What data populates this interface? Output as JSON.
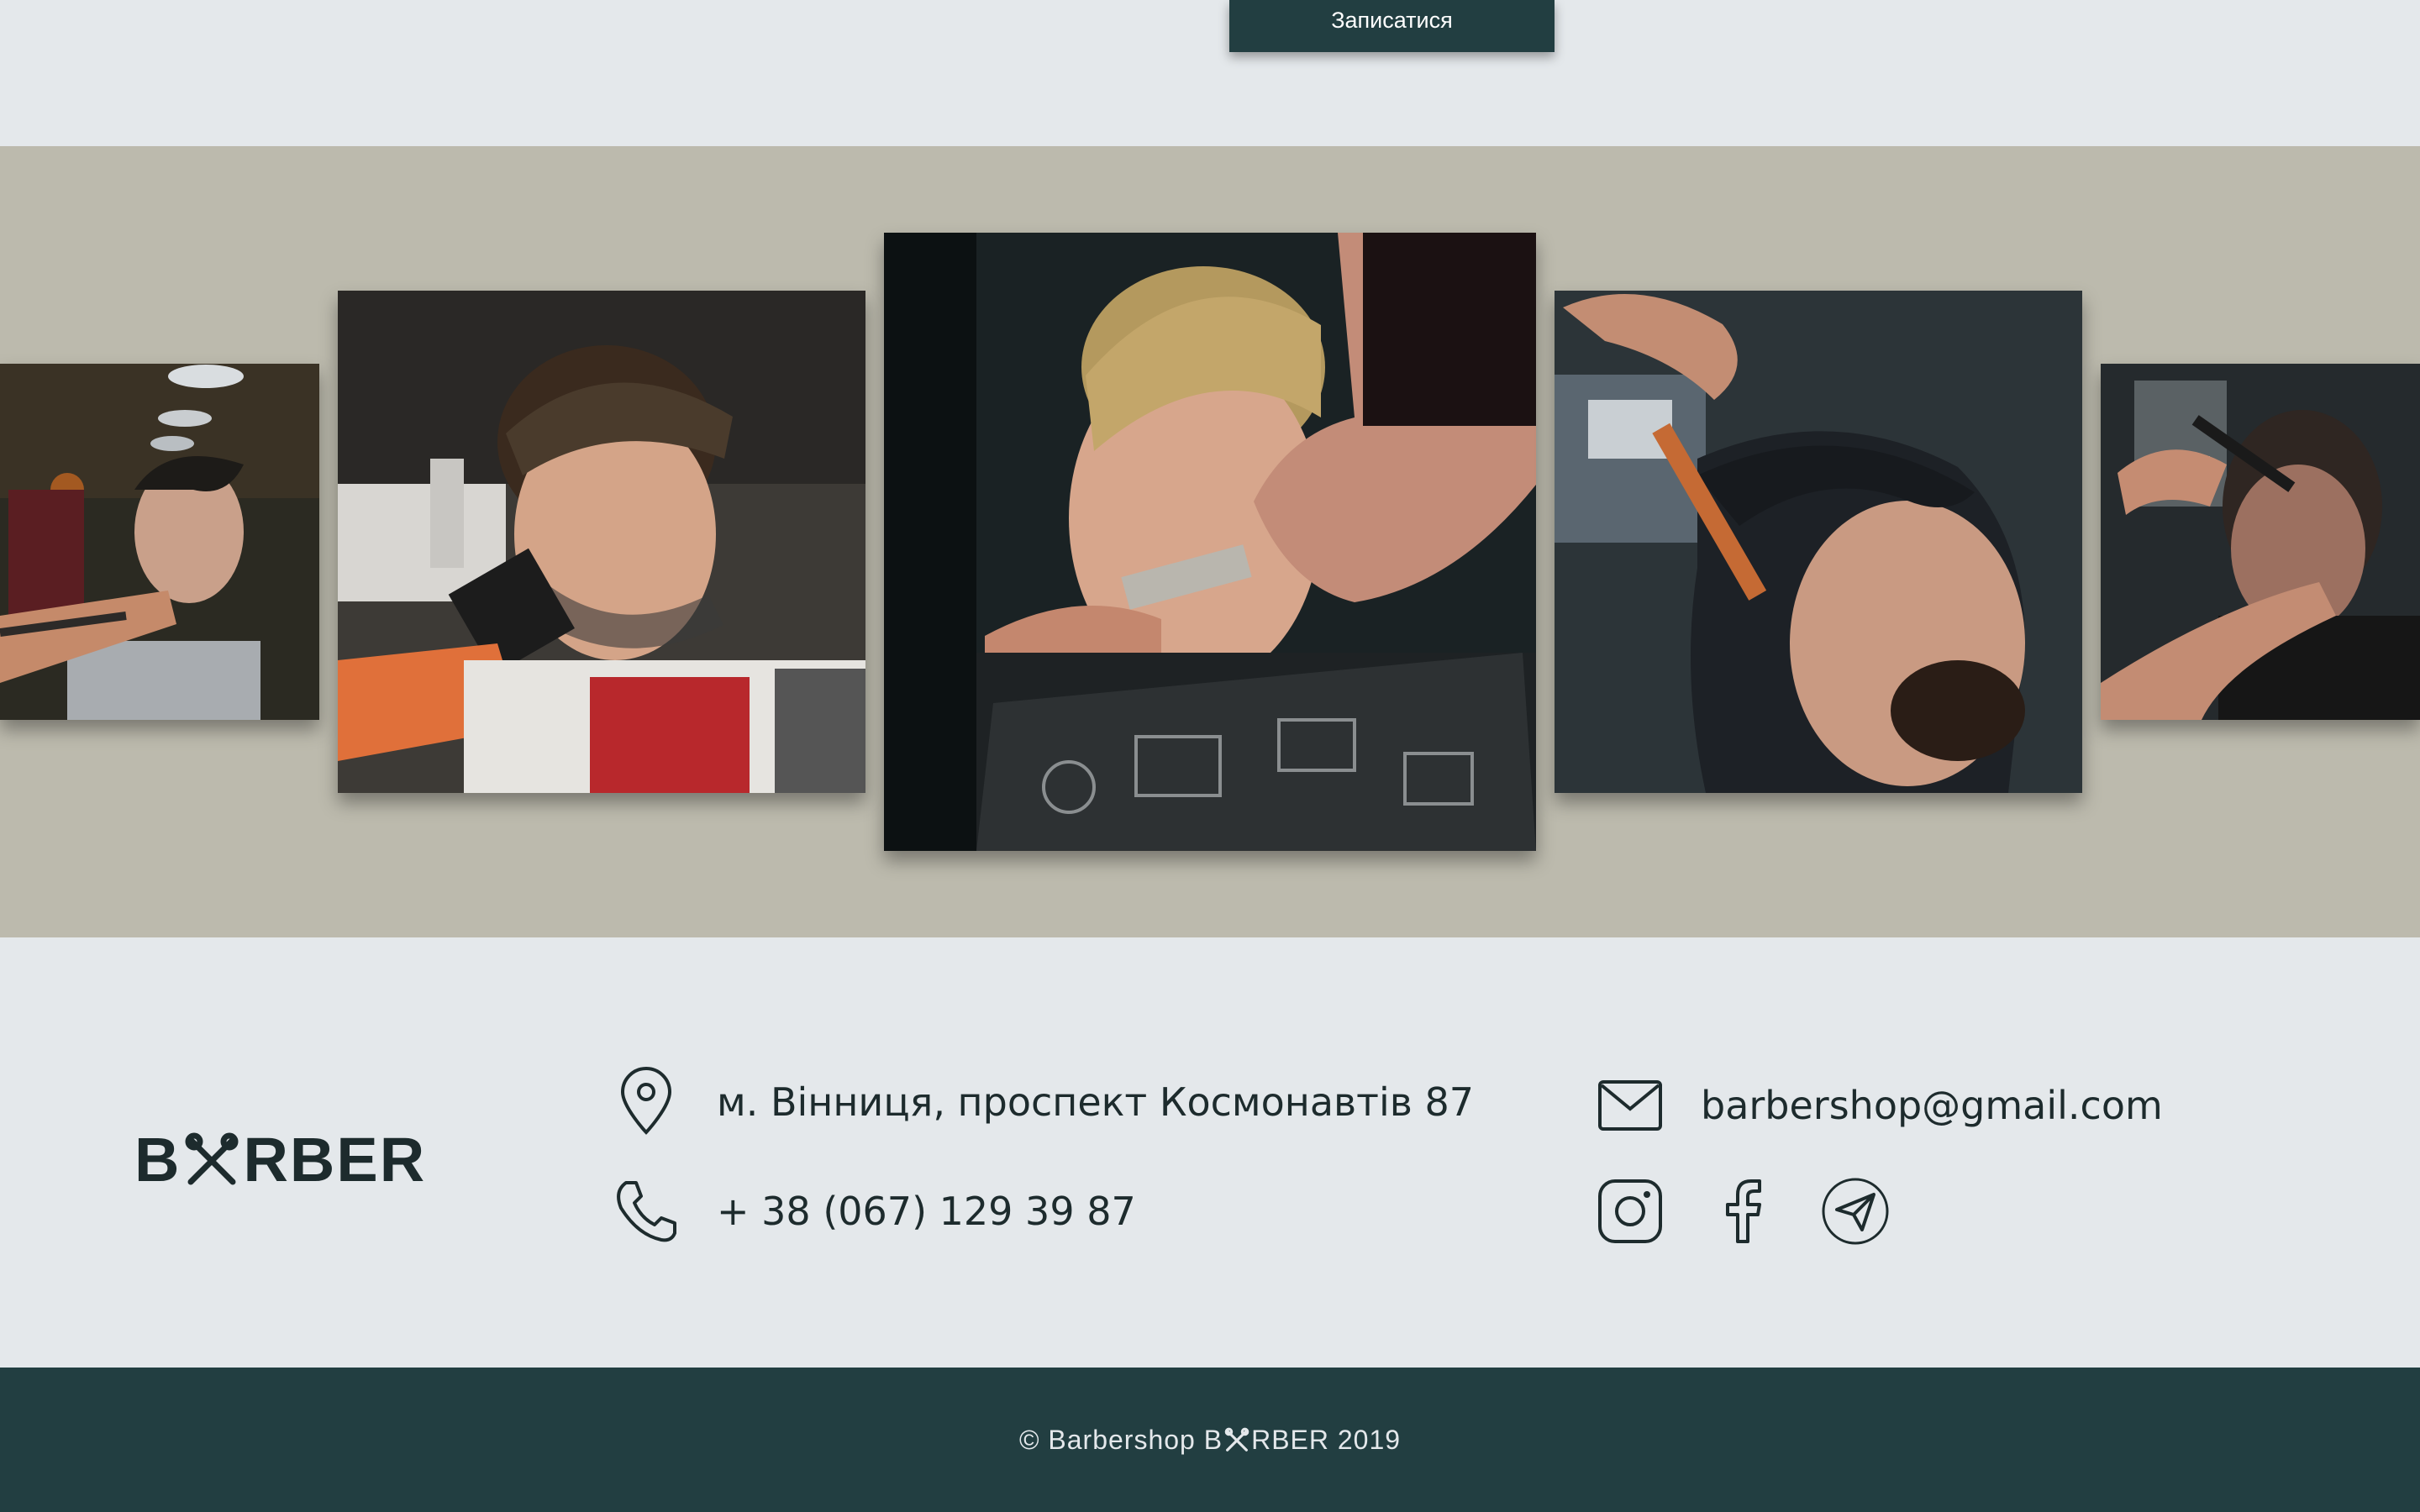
{
  "header": {
    "book_button_label": "Записатися"
  },
  "gallery": {
    "background_color": "#bcbaad",
    "slides": [
      {
        "position": "far-left",
        "alt": "barber-photo-1"
      },
      {
        "position": "left",
        "alt": "barber-photo-2"
      },
      {
        "position": "center",
        "alt": "barber-photo-3"
      },
      {
        "position": "right",
        "alt": "barber-photo-4"
      },
      {
        "position": "far-right",
        "alt": "barber-photo-5"
      }
    ]
  },
  "contacts": {
    "logo_left": "B",
    "logo_right": "RBER",
    "address": "м. Вінниця, проспект Космонавтів 87",
    "phone": "+ 38 (067) 129 39 87",
    "email": "barbershop@gmail.com",
    "socials": [
      "instagram-icon",
      "facebook-icon",
      "telegram-icon"
    ]
  },
  "footer": {
    "copyright_left": "© Barbershop B",
    "copyright_right": "RBER 2019"
  },
  "colors": {
    "dark_teal": "#223e41",
    "page_bg": "#e4e8eb",
    "band_bg": "#bcbaad",
    "text": "#1d2b2d"
  }
}
